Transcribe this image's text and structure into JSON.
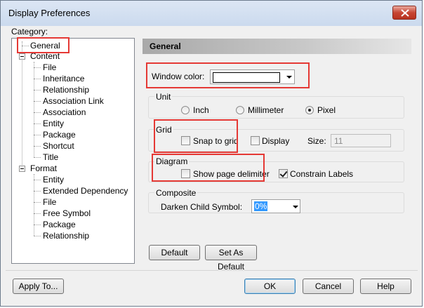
{
  "window": {
    "title": "Display Preferences"
  },
  "category": {
    "label": "Category:",
    "tree": [
      {
        "label": "General",
        "selected": true
      },
      {
        "label": "Content",
        "children": [
          "File",
          "Inheritance",
          "Relationship",
          "Association Link",
          "Association",
          "Entity",
          "Package",
          "Shortcut",
          "Title"
        ]
      },
      {
        "label": "Format",
        "children": [
          "Entity",
          "Extended Dependency",
          "File",
          "Free Symbol",
          "Package",
          "Relationship"
        ]
      }
    ]
  },
  "panel": {
    "title": "General",
    "window_color": {
      "label": "Window color:",
      "value_color": "#ffffff"
    },
    "unit": {
      "title": "Unit",
      "options": [
        "Inch",
        "Millimeter",
        "Pixel"
      ],
      "selected": "Pixel"
    },
    "grid": {
      "title": "Grid",
      "snap_label": "Snap to grid",
      "snap_checked": false,
      "display_label": "Display",
      "display_checked": false,
      "size_label": "Size:",
      "size_value": "11"
    },
    "diagram": {
      "title": "Diagram",
      "page_delimiter_label": "Show page delimiter",
      "page_delimiter_checked": false,
      "constrain_label": "Constrain Labels",
      "constrain_checked": true
    },
    "composite": {
      "title": "Composite",
      "darken_label": "Darken Child Symbol:",
      "darken_value": "0%"
    },
    "default_btn": "Default",
    "set_default_btn": "Set As Default"
  },
  "footer": {
    "apply_to": "Apply To...",
    "ok": "OK",
    "cancel": "Cancel",
    "help": "Help"
  },
  "colors": {
    "highlight": "#e53935",
    "selection_blue": "#3399ff"
  }
}
